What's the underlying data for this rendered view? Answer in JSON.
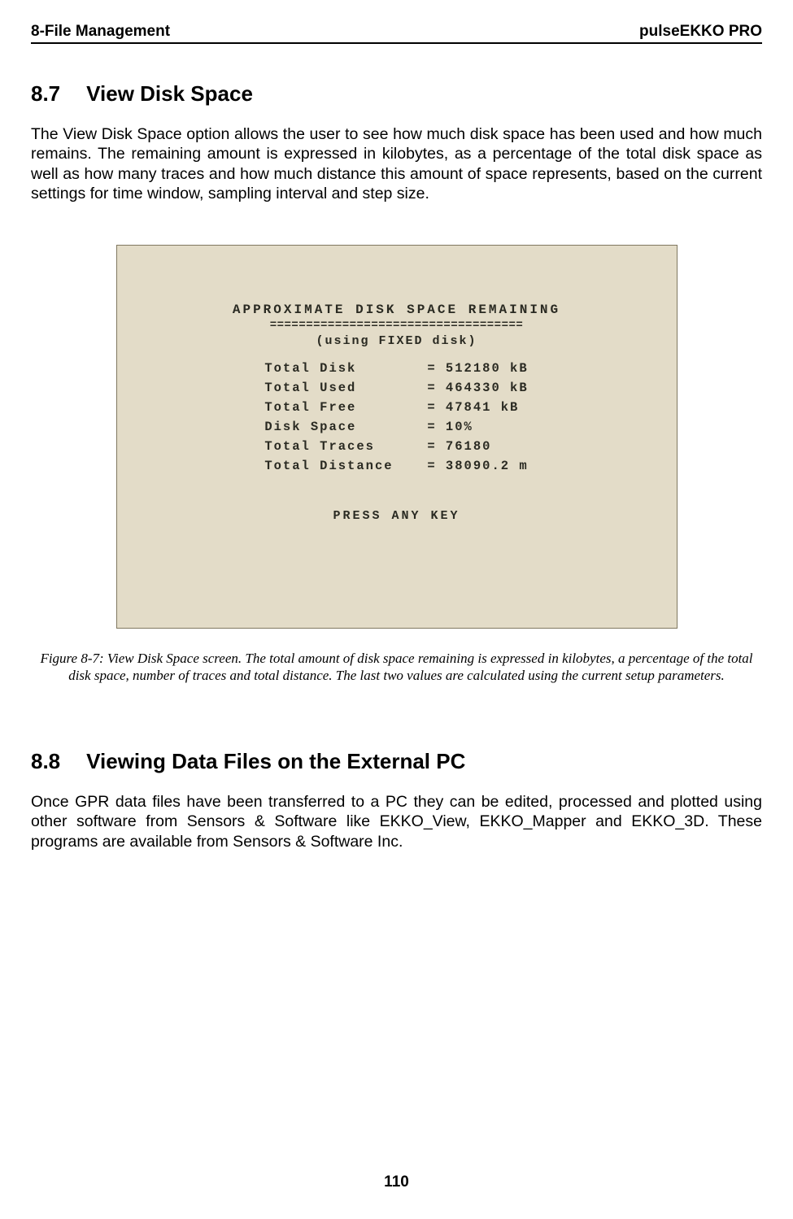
{
  "header": {
    "left": "8-File Management",
    "right": "pulseEKKO PRO"
  },
  "section87": {
    "num": "8.7",
    "title": "View Disk Space",
    "body": "The View Disk Space option allows the user to see how much disk space has been used and how much remains. The remaining amount is expressed in kilobytes, as a percentage of the total disk space as well as how many traces and how much distance this amount of space represents, based on the current settings for time window, sampling interval and step size."
  },
  "screenshot": {
    "title": "APPROXIMATE DISK SPACE REMAINING",
    "separator": "===================================",
    "subtitle": "(using FIXED disk)",
    "rows": [
      {
        "label": "Total Disk",
        "value": "= 512180 kB"
      },
      {
        "label": "Total Used",
        "value": "= 464330 kB"
      },
      {
        "label": "Total Free",
        "value": "= 47841 kB"
      },
      {
        "label": "Disk Space",
        "value": "= 10%"
      },
      {
        "label": "Total Traces",
        "value": "= 76180"
      },
      {
        "label": "Total Distance",
        "value": "= 38090.2 m"
      }
    ],
    "press": "PRESS ANY KEY"
  },
  "caption": "Figure 8-7:  View Disk Space screen. The total amount of disk space remaining is expressed in kilobytes, a percentage of the total disk space, number of traces and total distance. The last two values are calculated using the current setup parameters.",
  "section88": {
    "num": "8.8",
    "title": "Viewing Data Files on the External PC",
    "body": "Once GPR data files have been transferred to a PC they can be edited, processed and plotted using other software from Sensors & Software like EKKO_View, EKKO_Mapper and EKKO_3D. These programs are available from Sensors & Software Inc."
  },
  "pageNumber": "110"
}
